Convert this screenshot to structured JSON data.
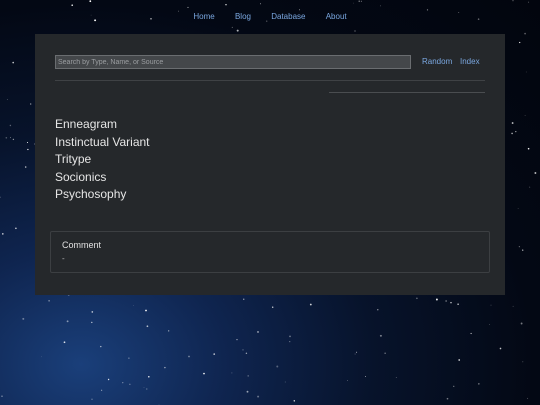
{
  "nav": {
    "items": [
      "Home",
      "Blog",
      "Database",
      "About"
    ]
  },
  "search": {
    "placeholder": "Search by Type, Name, or Source",
    "value": ""
  },
  "links": {
    "random": "Random",
    "index": "Index"
  },
  "categories": [
    "Enneagram",
    "Instinctual Variant",
    "Tritype",
    "Socionics",
    "Psychosophy"
  ],
  "comment": {
    "title": "Comment",
    "value": "-"
  },
  "colors": {
    "panel_bg": "#25282b",
    "link": "#7aa7e0",
    "text": "#e6e6e6",
    "input_bg": "#44474a"
  }
}
